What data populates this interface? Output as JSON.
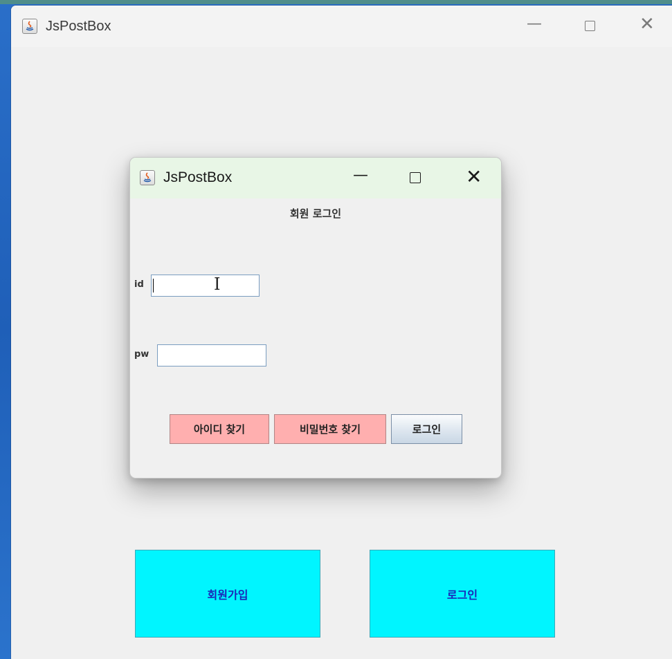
{
  "main_window": {
    "title": "JsPostBox",
    "controls": {
      "minimize": "—",
      "close": "✕"
    },
    "buttons": {
      "signup": "회원가입",
      "login": "로그인"
    }
  },
  "dialog": {
    "title": "JsPostBox",
    "controls": {
      "minimize": "—",
      "close": "✕"
    },
    "heading": "회원 로그인",
    "id_label": "id",
    "id_value": "",
    "pw_label": "pw",
    "pw_value": "",
    "buttons": {
      "find_id": "아이디 찾기",
      "find_pw": "비밀번호 찾기",
      "login": "로그인"
    }
  },
  "icons": [
    "java-app-icon",
    "minimize-icon",
    "maximize-icon",
    "close-icon",
    "text-cursor-icon"
  ]
}
